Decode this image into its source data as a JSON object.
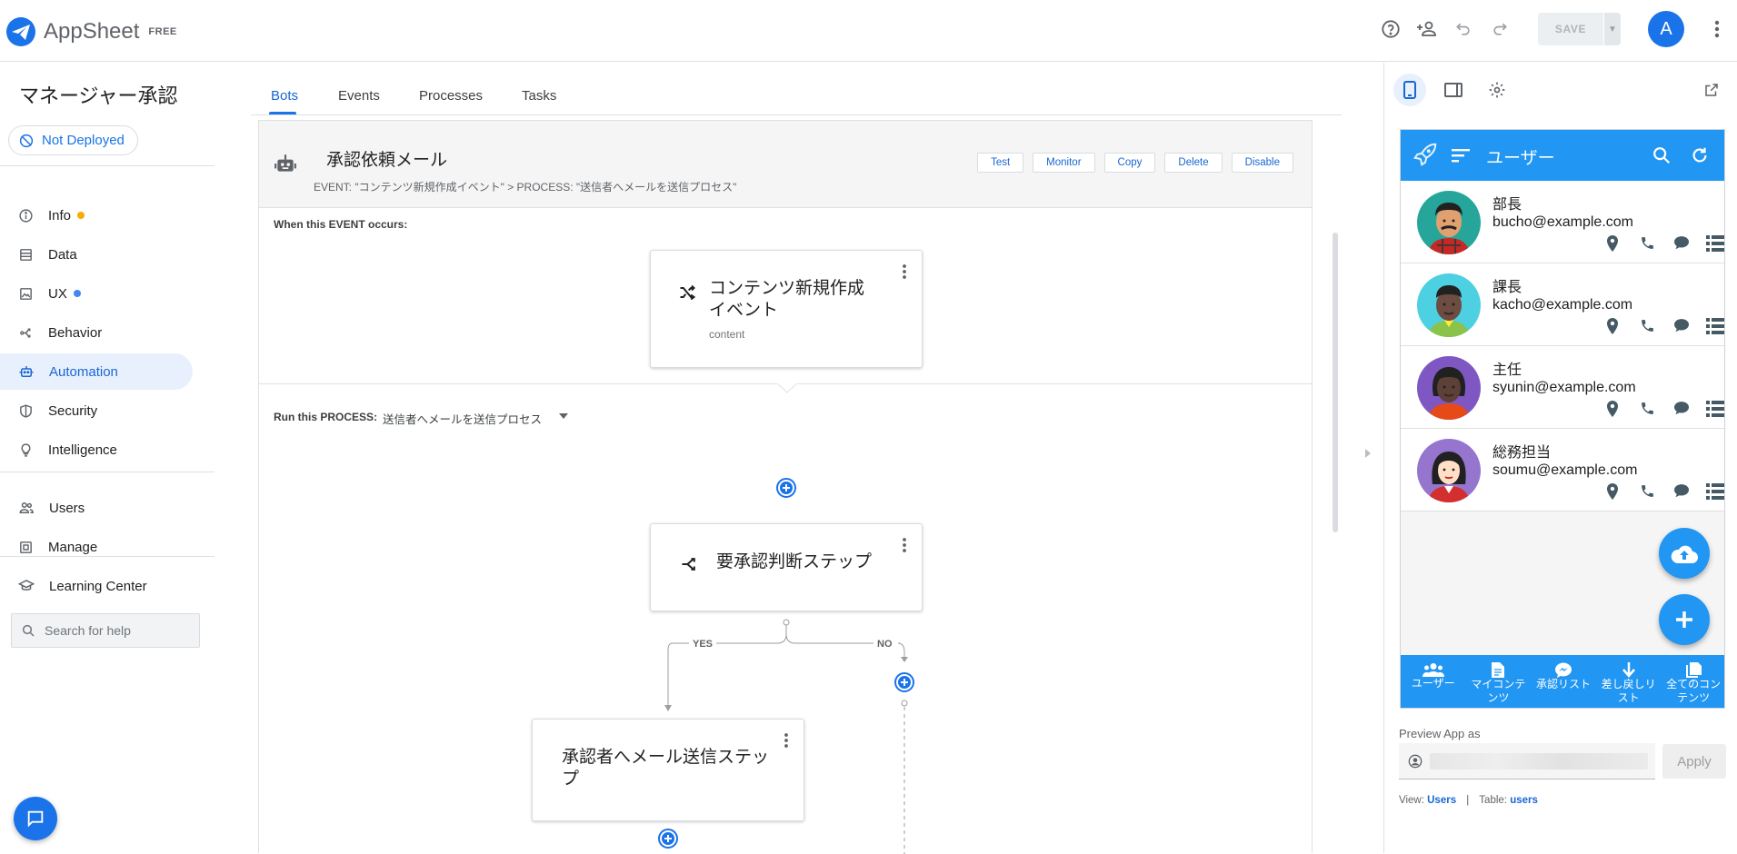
{
  "header": {
    "brand": "AppSheet",
    "plan": "FREE",
    "save_label": "SAVE",
    "user_initial": "A"
  },
  "sidebar": {
    "app_title": "マネージャー承認",
    "deploy_status": "Not Deployed",
    "items": [
      {
        "label": "Info"
      },
      {
        "label": "Data"
      },
      {
        "label": "UX"
      },
      {
        "label": "Behavior"
      },
      {
        "label": "Automation"
      },
      {
        "label": "Security"
      },
      {
        "label": "Intelligence"
      },
      {
        "label": "Users"
      },
      {
        "label": "Manage"
      },
      {
        "label": "Learning Center"
      }
    ],
    "search_placeholder": "Search for help",
    "colors": {
      "info_dot": "#f9ab00",
      "ux_dot": "#4285f4"
    }
  },
  "tabs": [
    "Bots",
    "Events",
    "Processes",
    "Tasks"
  ],
  "bot": {
    "name": "承認依頼メール",
    "subtitle": "EVENT: \"コンテンツ新規作成イベント\" > PROCESS: \"送信者へメールを送信プロセス\"",
    "actions": [
      "Test",
      "Monitor",
      "Copy",
      "Delete",
      "Disable"
    ],
    "when_label": "When this EVENT occurs:",
    "event": {
      "title": "コンテンツ新規作成イベント",
      "table": "content"
    },
    "run_label": "Run this PROCESS:",
    "process_name": "送信者へメールを送信プロセス",
    "branch_step": "要承認判断ステップ",
    "yes_label": "YES",
    "no_label": "NO",
    "mail_step": "承認者へメール送信ステップ"
  },
  "preview": {
    "view_title": "ユーザー",
    "users": [
      {
        "name": "部長",
        "email": "bucho@example.com"
      },
      {
        "name": "課長",
        "email": "kacho@example.com"
      },
      {
        "name": "主任",
        "email": "syunin@example.com"
      },
      {
        "name": "総務担当",
        "email": "soumu@example.com"
      }
    ],
    "bottom_nav": [
      "ユーザー",
      "マイコンテンツ",
      "承認リスト",
      "差し戻しリスト",
      "全てのコンテンツ"
    ],
    "preview_as_label": "Preview App as",
    "apply_label": "Apply",
    "view_prefix": "View:",
    "view_name": "Users",
    "table_prefix": "Table:",
    "table_name": "users",
    "accent": "#2196f3"
  }
}
